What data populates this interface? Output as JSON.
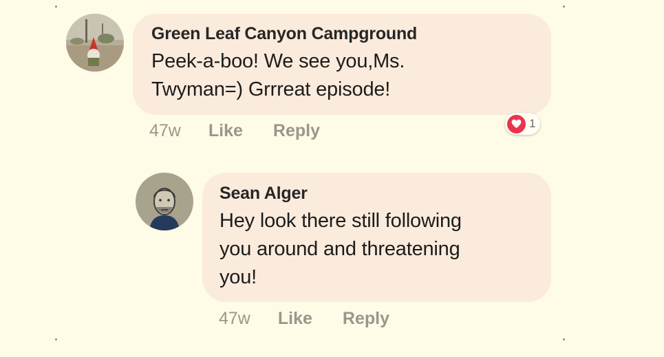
{
  "comments": [
    {
      "author": "Green Leaf Canyon Campground",
      "text_lines": [
        "Peek-a-boo! We see you,Ms.",
        "Twyman=)  Grrreat episode!"
      ],
      "timestamp": "47w",
      "like_label": "Like",
      "reply_label": "Reply",
      "reaction": {
        "icon": "heart-icon",
        "color": "#e8344e",
        "count": "1"
      }
    },
    {
      "author": "Sean Alger",
      "text_lines": [
        "Hey look there still following",
        "you around and threatening",
        "you!"
      ],
      "timestamp": "47w",
      "like_label": "Like",
      "reply_label": "Reply"
    }
  ],
  "colors": {
    "background": "#fefbe6",
    "bubble": "#fbebdc",
    "muted_text": "#9a968d"
  }
}
